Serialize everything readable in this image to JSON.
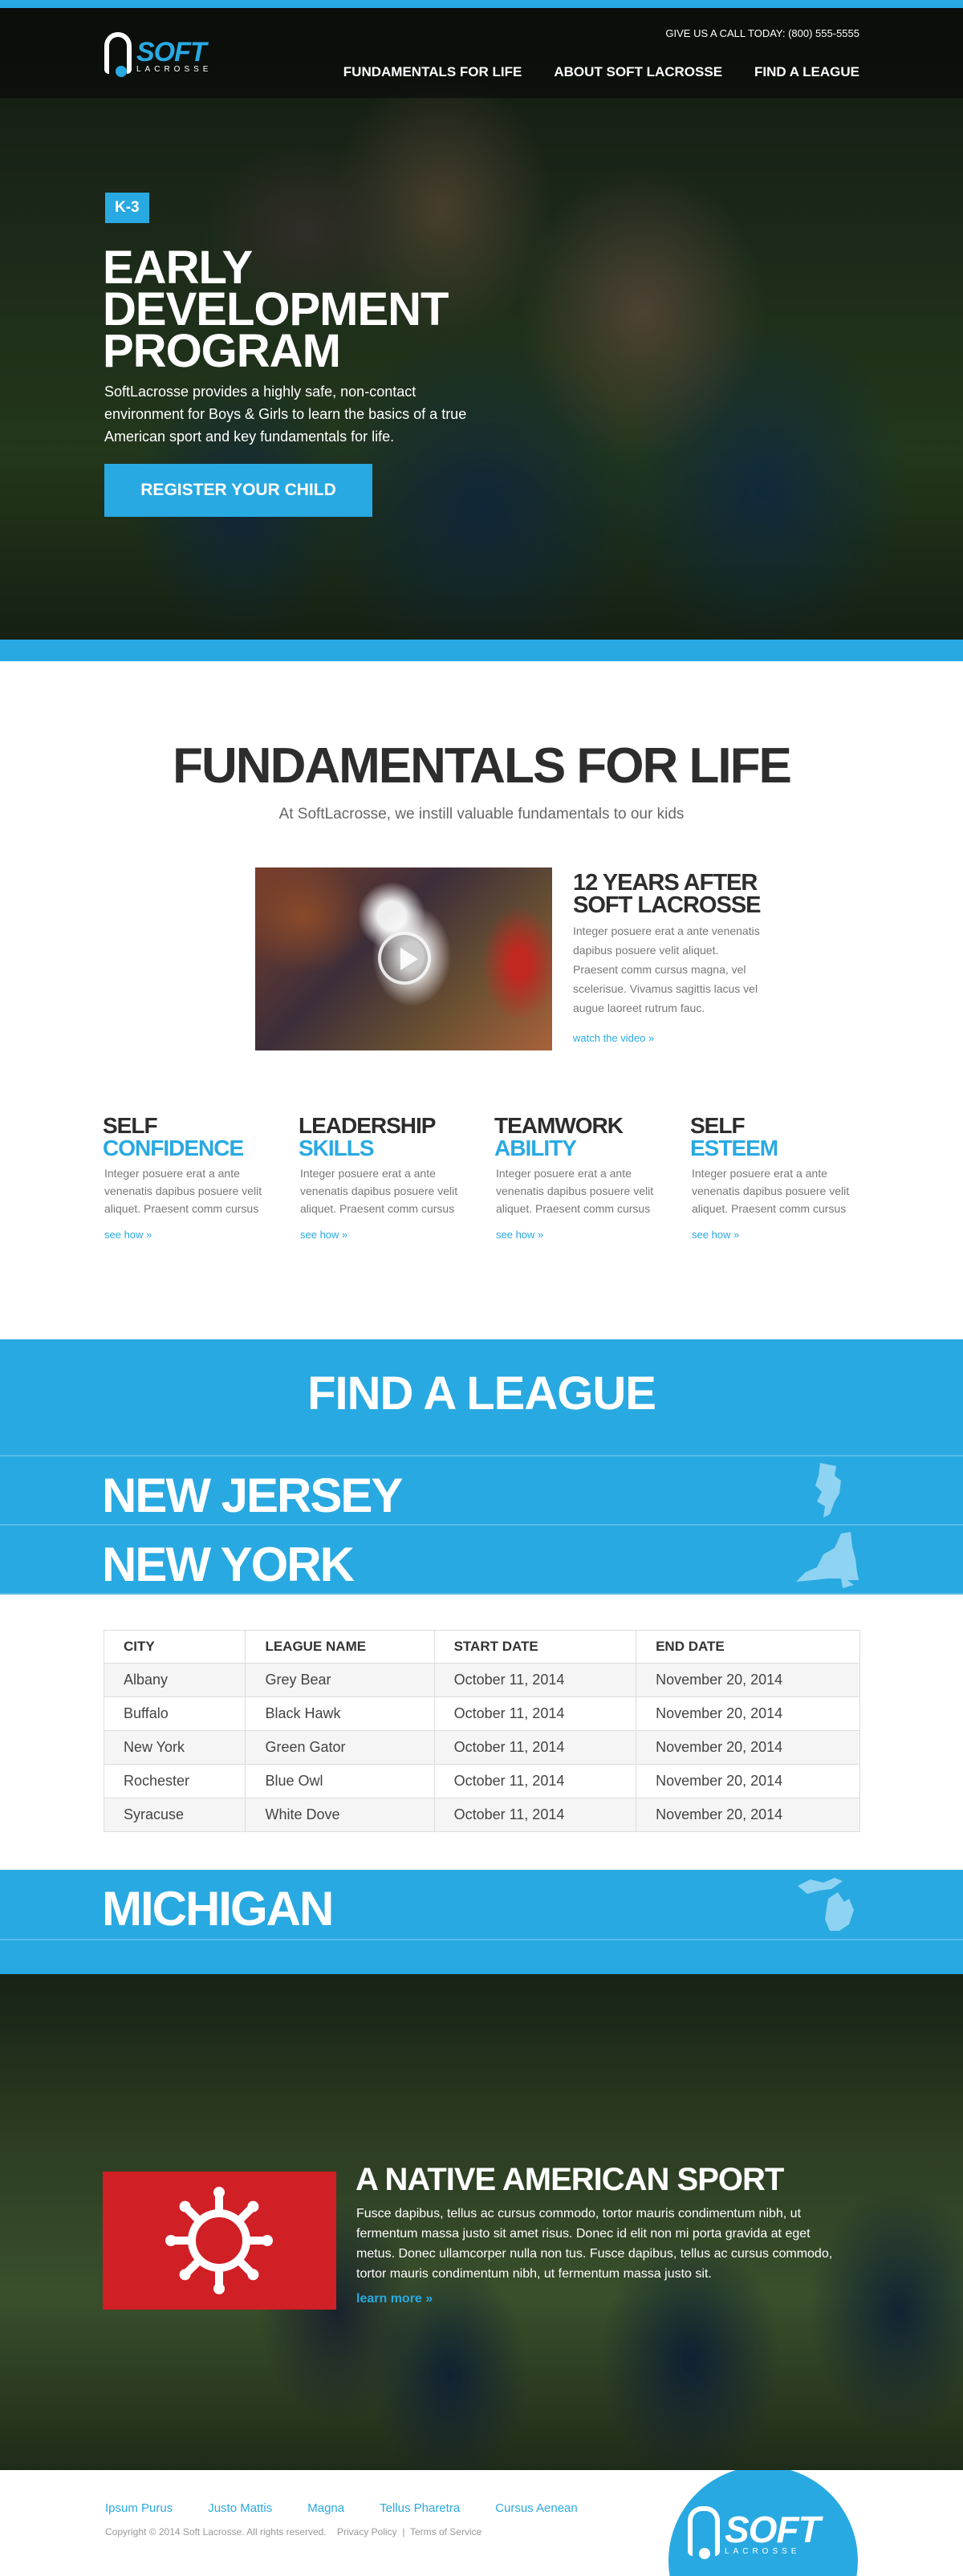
{
  "brand": {
    "logo_word": "SOFT",
    "logo_sub": "LACROSSE"
  },
  "header": {
    "call": "GIVE US A CALL TODAY: (800) 555-5555",
    "nav": [
      "FUNDAMENTALS FOR LIFE",
      "ABOUT SOFT LACROSSE",
      "FIND A LEAGUE"
    ]
  },
  "hero": {
    "badge": "K-3",
    "title": "EARLY DEVELOPMENT PROGRAM",
    "text": "SoftLacrosse provides a highly safe, non-contact environment for Boys & Girls to learn the basics of a true American sport and key fundamentals for life.",
    "cta": "REGISTER YOUR CHILD"
  },
  "fundamentals": {
    "title": "FUNDAMENTALS FOR LIFE",
    "subtitle": "At SoftLacrosse, we instill valuable fundamentals to our kids",
    "video_title": "12 YEARS AFTER SOFT LACROSSE",
    "video_text": "Integer posuere erat a ante venenatis dapibus posuere velit aliquet. Praesent comm cursus magna, vel scelerisue. Vivamus sagittis lacus vel augue laoreet rutrum fauc.",
    "video_link": "watch the video »",
    "values": [
      {
        "line1": "SELF",
        "line2": "CONFIDENCE",
        "text": "Integer posuere erat a ante venenatis dapibus posuere velit aliquet. Praesent comm cursus magna, vel scelerisue",
        "link": "see how »"
      },
      {
        "line1": "LEADERSHIP",
        "line2": "SKILLS",
        "text": "Integer posuere erat a ante venenatis dapibus posuere velit aliquet. Praesent comm cursus magna, vel scelerisue",
        "link": "see how »"
      },
      {
        "line1": "TEAMWORK",
        "line2": "ABILITY",
        "text": "Integer posuere erat a ante venenatis dapibus posuere velit aliquet. Praesent comm cursus magna, vel scelerisue",
        "link": "see how »"
      },
      {
        "line1": "SELF",
        "line2": "ESTEEM",
        "text": "Integer posuere erat a ante venenatis dapibus posuere velit aliquet. Praesent comm cursus magna, vel scelerisue",
        "link": "see how »"
      }
    ]
  },
  "league": {
    "title": "FIND A LEAGUE",
    "states": [
      "NEW JERSEY",
      "NEW YORK",
      "MICHIGAN"
    ],
    "table": {
      "headers": [
        "CITY",
        "LEAGUE NAME",
        "START DATE",
        "END DATE"
      ],
      "rows": [
        [
          "Albany",
          "Grey Bear",
          "October 11, 2014",
          "November 20, 2014"
        ],
        [
          "Buffalo",
          "Black Hawk",
          "October 11, 2014",
          "November 20, 2014"
        ],
        [
          "New York",
          "Green Gator",
          "October 11, 2014",
          "November 20, 2014"
        ],
        [
          "Rochester",
          "Blue Owl",
          "October 11, 2014",
          "November 20, 2014"
        ],
        [
          "Syracuse",
          "White Dove",
          "October 11, 2014",
          "November 20, 2014"
        ]
      ]
    }
  },
  "native": {
    "title": "A NATIVE AMERICAN SPORT",
    "text": "Fusce dapibus, tellus ac cursus commodo, tortor mauris condimentum nibh, ut fermentum massa justo sit amet risus. Donec id elit non mi porta gravida at eget metus. Donec ullamcorper nulla non tus. Fusce dapibus, tellus ac cursus commodo, tortor mauris condimentum nibh, ut fermentum massa justo sit.",
    "link": "learn more »"
  },
  "footer": {
    "links": [
      "Ipsum Purus",
      "Justo Mattis",
      "Magna",
      "Tellus Pharetra",
      "Cursus Aenean"
    ],
    "copyright": "Copyright © 2014 Soft Lacrosse. All rights reserved.",
    "privacy": "Privacy Policy",
    "separator": "|",
    "terms": "Terms of Service"
  },
  "colors": {
    "accent": "#29a9e1",
    "flag": "#d01f25",
    "dark_text": "#2d2d2d"
  },
  "icons": [
    "play-icon",
    "new-jersey-map-icon",
    "new-york-map-icon",
    "michigan-map-icon",
    "native-sun-emblem-icon"
  ]
}
